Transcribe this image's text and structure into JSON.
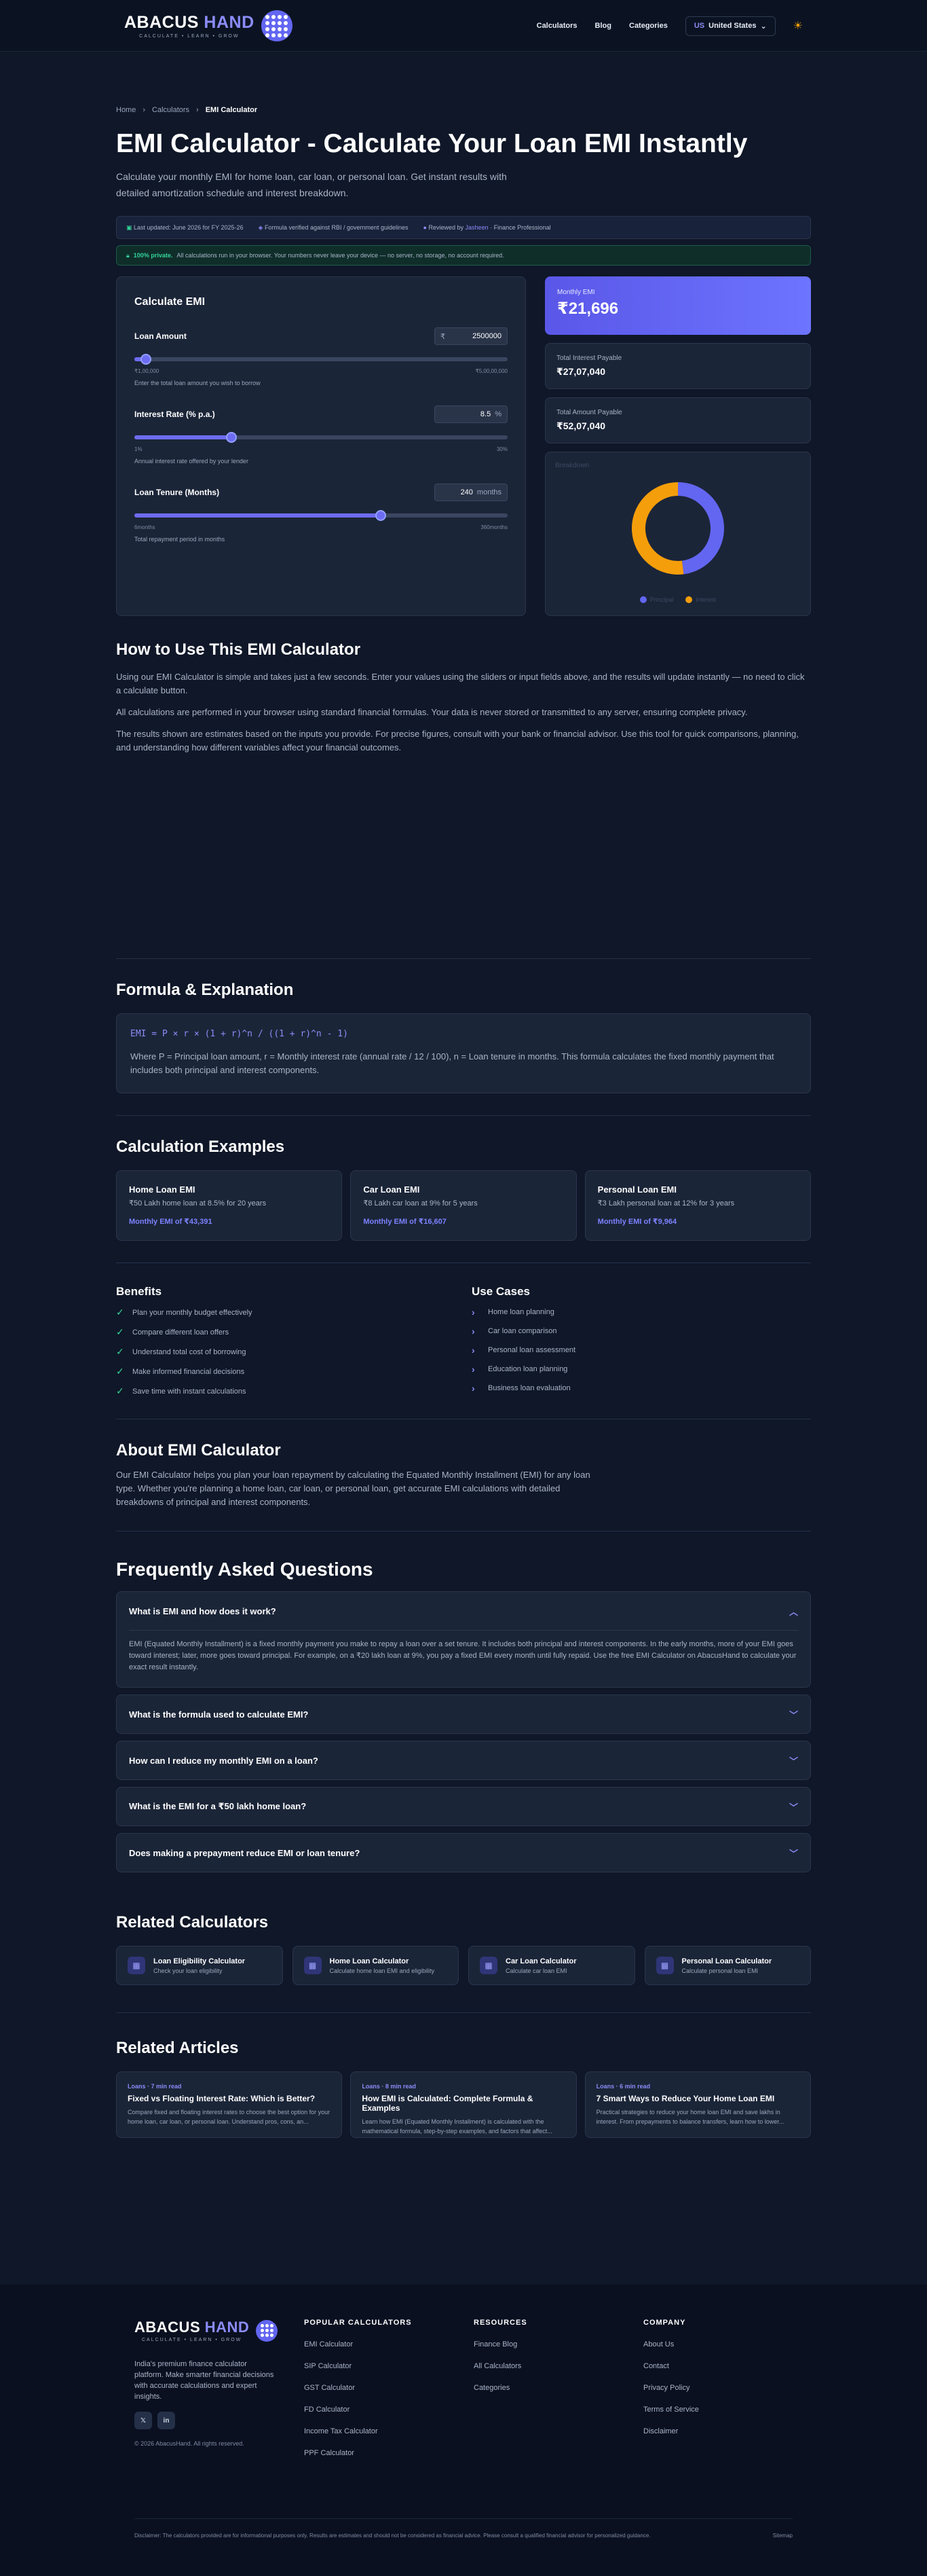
{
  "header": {
    "logo_text_1": "ABACUS",
    "logo_text_2": "HAND",
    "logo_tagline": "CALCULATE • LEARN • GROW",
    "nav": [
      "Calculators",
      "Blog",
      "Categories"
    ],
    "country_code": "US",
    "country_name": "United States"
  },
  "breadcrumb": [
    "Home",
    "Calculators",
    "EMI Calculator"
  ],
  "page": {
    "title": "EMI Calculator - Calculate Your Loan EMI Instantly",
    "lead": "Calculate your monthly EMI for home loan, car loan, or personal loan. Get instant results with detailed amortization schedule and interest breakdown.",
    "meta_updated": "Last updated: June 2026 for FY 2025-26",
    "meta_formula": "Formula verified against RBI / government guidelines",
    "meta_reviewed_prefix": "Reviewed by",
    "meta_reviewer": "Jasheen",
    "meta_reviewed_suffix": "· Finance Professional",
    "privacy_tag": "100% private.",
    "privacy_text": "All calculations run in your browser. Your numbers never leave your device — no server, no storage, no account required."
  },
  "calculator": {
    "title": "Calculate EMI",
    "loan_amount": {
      "label": "Loan Amount",
      "prefix": "₹",
      "value": "2500000",
      "min": "₹1,00,000",
      "max": "₹5,00,00,000",
      "hint": "Enter the total loan amount you wish to borrow",
      "fraction": 0.05
    },
    "interest_rate": {
      "label": "Interest Rate (% p.a.)",
      "value": "8.5",
      "suffix": "%",
      "min": "1%",
      "max": "30%",
      "hint": "Annual interest rate offered by your lender",
      "fraction": 0.27
    },
    "tenure": {
      "label": "Loan Tenure (Months)",
      "value": "240",
      "suffix": "months",
      "min": "6months",
      "max": "360months",
      "hint": "Total repayment period in months",
      "fraction": 0.66
    }
  },
  "results": {
    "monthly_emi_label": "Monthly EMI",
    "monthly_emi": "₹21,696",
    "total_interest_label": "Total Interest Payable",
    "total_interest": "₹27,07,040",
    "total_amount_label": "Total Amount Payable",
    "total_amount": "₹52,07,040",
    "chart_title": "Breakdown",
    "principal_label": "Principal",
    "interest_label": "Interest",
    "principal_color": "#6366f1",
    "interest_color": "#f59e0b"
  },
  "chart_data": {
    "type": "pie",
    "categories": [
      "Principal",
      "Interest"
    ],
    "values": [
      2500000,
      2707040
    ],
    "colors": [
      "#6366f1",
      "#f59e0b"
    ]
  },
  "how_to": {
    "title": "How to Use This EMI Calculator",
    "p1": "Using our EMI Calculator is simple and takes just a few seconds. Enter your values using the sliders or input fields above, and the results will update instantly — no need to click a calculate button.",
    "p2": "All calculations are performed in your browser using standard financial formulas. Your data is never stored or transmitted to any server, ensuring complete privacy.",
    "p3": "The results shown are estimates based on the inputs you provide. For precise figures, consult with your bank or financial advisor. Use this tool for quick comparisons, planning, and understanding how different variables affect your financial outcomes."
  },
  "formula": {
    "title": "Formula & Explanation",
    "code": "EMI = P × r × (1 + r)^n / ((1 + r)^n - 1)",
    "desc": "Where P = Principal loan amount, r = Monthly interest rate (annual rate / 12 / 100), n = Loan tenure in months. This formula calculates the fixed monthly payment that includes both principal and interest components."
  },
  "examples": {
    "title": "Calculation Examples",
    "items": [
      {
        "title": "Home Loan EMI",
        "desc": "₹50 Lakh home loan at 8.5% for 20 years",
        "result": "Monthly EMI of ₹43,391"
      },
      {
        "title": "Car Loan EMI",
        "desc": "₹8 Lakh car loan at 9% for 5 years",
        "result": "Monthly EMI of ₹16,607"
      },
      {
        "title": "Personal Loan EMI",
        "desc": "₹3 Lakh personal loan at 12% for 3 years",
        "result": "Monthly EMI of ₹9,964"
      }
    ]
  },
  "benefits": {
    "title": "Benefits",
    "items": [
      "Plan your monthly budget effectively",
      "Compare different loan offers",
      "Understand total cost of borrowing",
      "Make informed financial decisions",
      "Save time with instant calculations"
    ]
  },
  "use_cases": {
    "title": "Use Cases",
    "items": [
      "Home loan planning",
      "Car loan comparison",
      "Personal loan assessment",
      "Education loan planning",
      "Business loan evaluation"
    ]
  },
  "about": {
    "title": "About EMI Calculator",
    "text": "Our EMI Calculator helps you plan your loan repayment by calculating the Equated Monthly Installment (EMI) for any loan type. Whether you're planning a home loan, car loan, or personal loan, get accurate EMI calculations with detailed breakdowns of principal and interest components."
  },
  "faq": {
    "title": "Frequently Asked Questions",
    "items": [
      {
        "q": "What is EMI and how does it work?",
        "a": "EMI (Equated Monthly Installment) is a fixed monthly payment you make to repay a loan over a set tenure. It includes both principal and interest components. In the early months, more of your EMI goes toward interest; later, more goes toward principal. For example, on a ₹20 lakh loan at 9%, you pay a fixed EMI every month until fully repaid. Use the free EMI Calculator on AbacusHand to calculate your exact result instantly."
      },
      {
        "q": "What is the formula used to calculate EMI?"
      },
      {
        "q": "How can I reduce my monthly EMI on a loan?"
      },
      {
        "q": "What is the EMI for a ₹50 lakh home loan?"
      },
      {
        "q": "Does making a prepayment reduce EMI or loan tenure?"
      }
    ]
  },
  "related_calculators": {
    "title": "Related Calculators",
    "items": [
      {
        "title": "Loan Eligibility Calculator",
        "desc": "Check your loan eligibility"
      },
      {
        "title": "Home Loan Calculator",
        "desc": "Calculate home loan EMI and eligibility"
      },
      {
        "title": "Car Loan Calculator",
        "desc": "Calculate car loan EMI"
      },
      {
        "title": "Personal Loan Calculator",
        "desc": "Calculate personal loan EMI"
      }
    ]
  },
  "related_articles": {
    "title": "Related Articles",
    "items": [
      {
        "tag": "Loans · 7 min read",
        "title": "Fixed vs Floating Interest Rate: Which is Better?",
        "desc": "Compare fixed and floating interest rates to choose the best option for your home loan, car loan, or personal loan. Understand pros, cons, an..."
      },
      {
        "tag": "Loans · 8 min read",
        "title": "How EMI is Calculated: Complete Formula & Examples",
        "desc": "Learn how EMI (Equated Monthly Installment) is calculated with the mathematical formula, step-by-step examples, and factors that affect..."
      },
      {
        "tag": "Loans · 6 min read",
        "title": "7 Smart Ways to Reduce Your Home Loan EMI",
        "desc": "Practical strategies to reduce your home loan EMI and save lakhs in interest. From prepayments to balance transfers, learn how to lower..."
      }
    ]
  },
  "footer": {
    "desc": "India's premium finance calculator platform. Make smarter financial decisions with accurate calculations and expert insights.",
    "copyright": "© 2026 AbacusHand. All rights reserved.",
    "cols": [
      {
        "title": "POPULAR CALCULATORS",
        "links": [
          "EMI Calculator",
          "SIP Calculator",
          "GST Calculator",
          "FD Calculator",
          "Income Tax Calculator",
          "PPF Calculator"
        ]
      },
      {
        "title": "RESOURCES",
        "links": [
          "Finance Blog",
          "All Calculators",
          "Categories"
        ]
      },
      {
        "title": "COMPANY",
        "links": [
          "About Us",
          "Contact",
          "Privacy Policy",
          "Terms of Service",
          "Disclaimer"
        ]
      }
    ],
    "disclaimer": "Disclaimer: The calculators provided are for informational purposes only. Results are estimates and should not be considered as financial advice. Please consult a qualified financial advisor for personalized guidance.",
    "sitemap": "Sitemap"
  }
}
